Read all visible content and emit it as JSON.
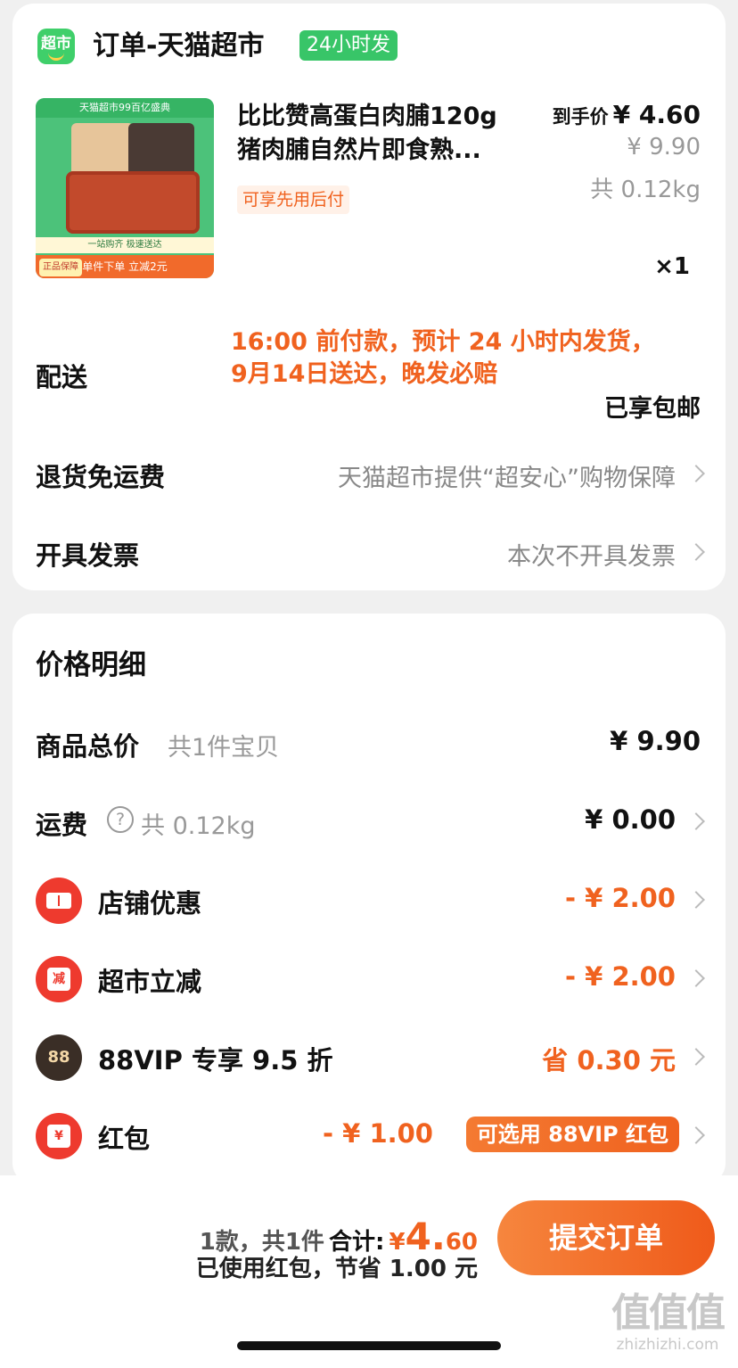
{
  "shop": {
    "icon_text": "超市",
    "title": "订单-天猫超市",
    "tag": "24小时发"
  },
  "product": {
    "image": {
      "banner": "天猫超市99百亿盛典",
      "strip1": "一站购齐 极速送达",
      "strip2": "单件下单 立减2元",
      "guarantee": "正品保障"
    },
    "name_line1": "比比赞高蛋白肉脯120g",
    "name_line2": "猪肉脯自然片即食熟...",
    "pay_later": "可享先用后付",
    "final_price_label": "到手价",
    "final_price": "¥ 4.60",
    "original_price": "¥ 9.90",
    "weight": "共 0.12kg",
    "quantity": "×1"
  },
  "delivery": {
    "label": "配送",
    "info_line1": "16:00 前付款，预计 24 小时内发货，",
    "info_line2": "9月14日送达，晚发必赔",
    "free_shipping": "已享包邮"
  },
  "return": {
    "label": "退货免运费",
    "value": "天猫超市提供“超安心”购物保障"
  },
  "invoice": {
    "label": "开具发票",
    "value": "本次不开具发票"
  },
  "price_detail": {
    "title": "价格明细",
    "goods_total": {
      "label": "商品总价",
      "sub": "共1件宝贝",
      "value": "¥ 9.90"
    },
    "shipping": {
      "label": "运费",
      "sub": "共 0.12kg",
      "value": "¥ 0.00"
    },
    "shop_discount": {
      "label": "店铺优惠",
      "value": "- ¥ 2.00"
    },
    "market_discount": {
      "label": "超市立减",
      "icon_text": "减",
      "value": "- ¥ 2.00"
    },
    "vip": {
      "label": "88VIP 专享 9.5 折",
      "icon_text": "88",
      "value": "省 0.30 元"
    },
    "red_packet": {
      "label": "红包",
      "icon_text": "¥",
      "value": "- ¥ 1.00",
      "tag": "可选用 88VIP 红包"
    }
  },
  "bottom": {
    "count_text": "1款，共1件",
    "total_label": "合计:",
    "currency": "¥",
    "total_int": "4.",
    "total_dec": "60",
    "saved_text": "已使用红包，节省 1.00 元",
    "submit": "提交订单"
  },
  "watermark": {
    "text": "值值值",
    "url": "zhizhizhi.com"
  },
  "colors": {
    "accent": "#f0621f",
    "green": "#38c568",
    "red": "#ee3a2e"
  }
}
